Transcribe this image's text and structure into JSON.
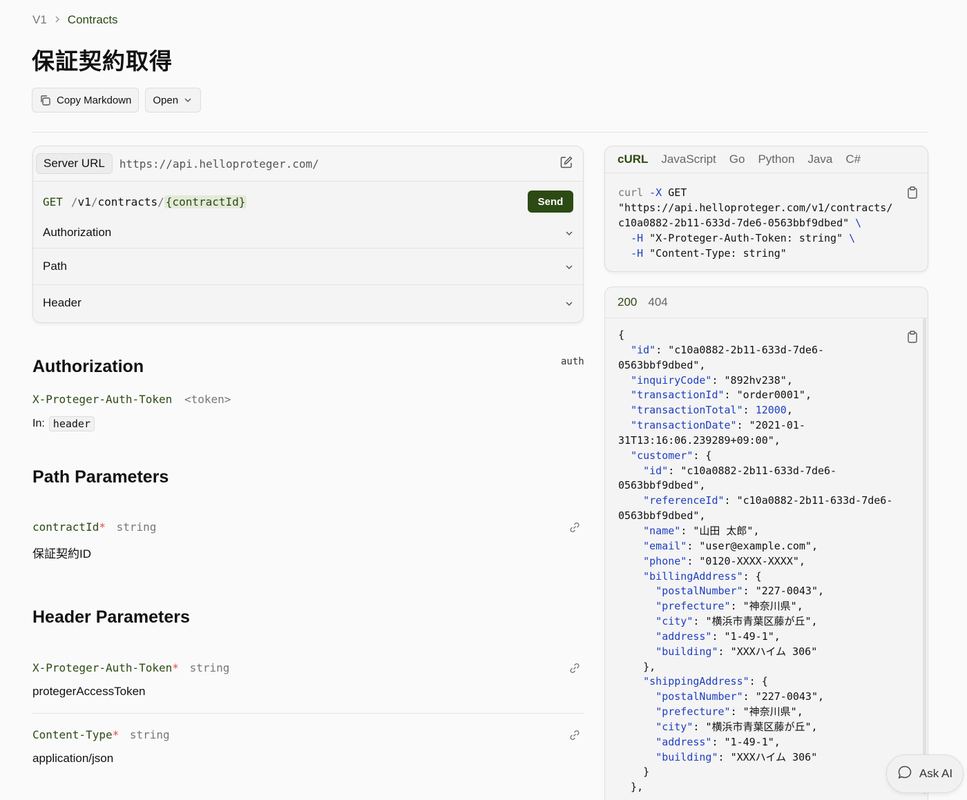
{
  "breadcrumb": {
    "root": "V1",
    "current": "Contracts"
  },
  "page": {
    "title": "保証契約取得"
  },
  "actions": {
    "copy_markdown": "Copy Markdown",
    "open": "Open"
  },
  "request": {
    "server_label": "Server URL",
    "server_url": "https://api.helloproteger.com/",
    "method": "GET",
    "path_seg1": "v1",
    "path_seg2": "contracts",
    "path_param": "{contractId}",
    "send": "Send",
    "sections": [
      "Authorization",
      "Path",
      "Header"
    ]
  },
  "auth_section": {
    "title": "Authorization",
    "badge": "auth",
    "field_name": "X-Proteger-Auth-Token",
    "field_value": "<token>",
    "in_label": "In:",
    "in_value": "header"
  },
  "path_section": {
    "title": "Path Parameters",
    "param_name": "contractId",
    "required": "*",
    "param_type": "string",
    "param_desc": "保証契約ID"
  },
  "header_section": {
    "title": "Header Parameters",
    "params": [
      {
        "name": "X-Proteger-Auth-Token",
        "required": "*",
        "type": "string",
        "desc": "protegerAccessToken"
      },
      {
        "name": "Content-Type",
        "required": "*",
        "type": "string",
        "desc": "application/json"
      }
    ]
  },
  "code_samples": {
    "tabs": [
      "cURL",
      "JavaScript",
      "Go",
      "Python",
      "Java",
      "C#"
    ],
    "active_tab": "cURL",
    "curl": {
      "line1_cmd": "curl",
      "line1_flag": "-X",
      "line1_method": "GET",
      "line2": "\"https://api.helloproteger.com/v1/contracts/",
      "line3": "c10a0882-2b11-633d-7de6-0563bbf9dbed\"",
      "line3_cont": "\\",
      "line4_flag": "-H",
      "line4": "\"X-Proteger-Auth-Token: string\"",
      "line4_cont": "\\",
      "line5_flag": "-H",
      "line5": "\"Content-Type: string\""
    }
  },
  "response": {
    "tabs": [
      "200",
      "404"
    ],
    "active_tab": "200",
    "json": {
      "id": "\"c10a0882-2b11-633d-7de6-",
      "id2": "0563bbf9dbed\"",
      "inquiryCode": "\"892hv238\"",
      "transactionId": "\"order0001\"",
      "transactionTotal": "12000",
      "transactionDate": "\"2021-01-",
      "transactionDate2": "31T13:16:06.239289+09:00\"",
      "customer_id": "\"c10a0882-2b11-633d-7de6-",
      "customer_id2": "0563bbf9dbed\"",
      "referenceId": "\"c10a0882-2b11-633d-7de6-",
      "referenceId2": "0563bbf9dbed\"",
      "name": "\"山田 太郎\"",
      "email": "\"user@example.com\"",
      "phone": "\"0120-XXXX-XXXX\"",
      "postalNumber": "\"227-0043\"",
      "prefecture": "\"神奈川県\"",
      "city": "\"横浜市青葉区藤が丘\"",
      "address": "\"1-49-1\"",
      "building": "\"XXXハイム 306\""
    }
  },
  "ask_ai": "Ask AI"
}
